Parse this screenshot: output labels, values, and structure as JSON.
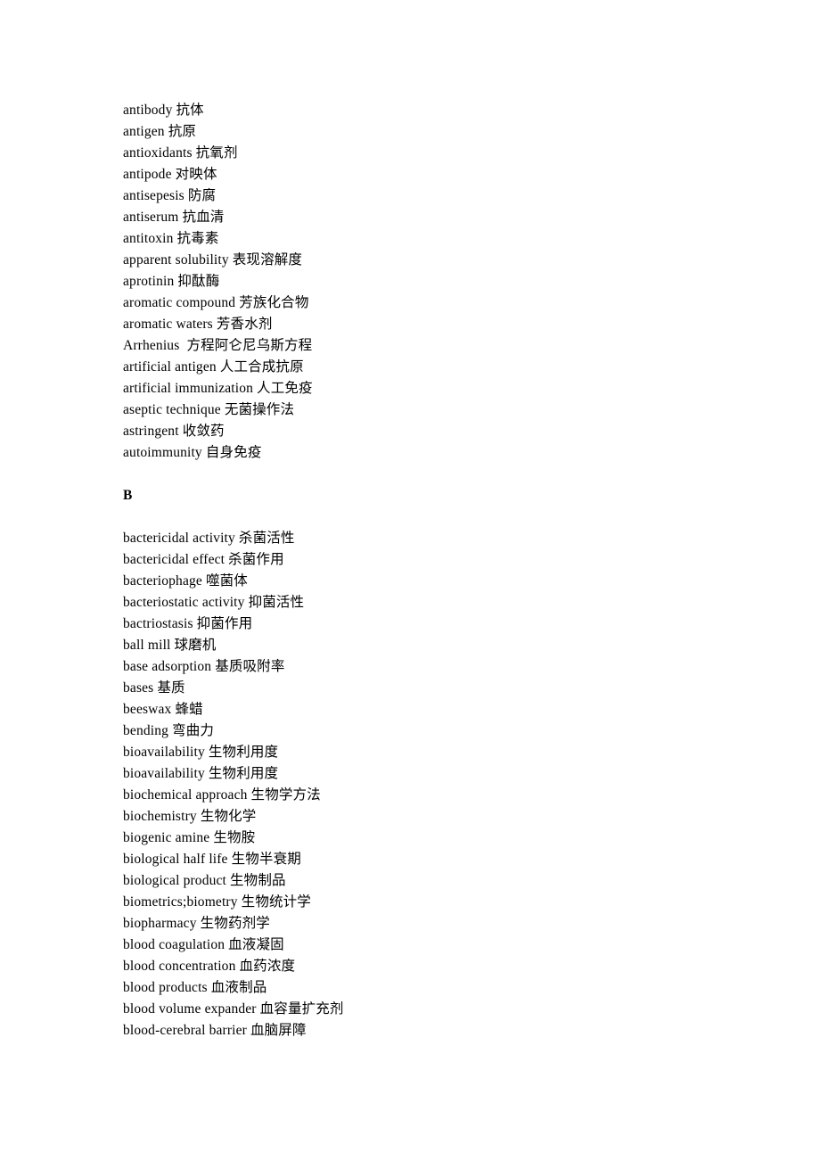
{
  "document": {
    "type": "glossary",
    "language_pair": "English-Chinese",
    "heading_a_section_continued": true
  },
  "blocks": [
    {
      "kind": "entry",
      "text": "antibody 抗体"
    },
    {
      "kind": "entry",
      "text": "antigen 抗原"
    },
    {
      "kind": "entry",
      "text": "antioxidants 抗氧剂"
    },
    {
      "kind": "entry",
      "text": "antipode 对映体"
    },
    {
      "kind": "entry",
      "text": "antisepesis 防腐"
    },
    {
      "kind": "entry",
      "text": "antiserum 抗血清"
    },
    {
      "kind": "entry",
      "text": "antitoxin 抗毒素"
    },
    {
      "kind": "entry",
      "text": "apparent solubility 表现溶解度"
    },
    {
      "kind": "entry",
      "text": "aprotinin 抑酞酶"
    },
    {
      "kind": "entry",
      "text": "aromatic compound 芳族化合物"
    },
    {
      "kind": "entry",
      "text": "aromatic waters 芳香水剂"
    },
    {
      "kind": "entry",
      "text": "Arrhenius  方程阿仑尼乌斯方程"
    },
    {
      "kind": "entry",
      "text": "artificial antigen 人工合成抗原"
    },
    {
      "kind": "entry",
      "text": "artificial immunization 人工免疫"
    },
    {
      "kind": "entry",
      "text": "aseptic technique 无菌操作法"
    },
    {
      "kind": "entry",
      "text": "astringent 收敛药"
    },
    {
      "kind": "entry",
      "text": "autoimmunity 自身免疫"
    },
    {
      "kind": "spacer",
      "text": ""
    },
    {
      "kind": "heading",
      "text": "B"
    },
    {
      "kind": "spacer",
      "text": ""
    },
    {
      "kind": "entry",
      "text": "bactericidal activity 杀菌活性"
    },
    {
      "kind": "entry",
      "text": "bactericidal effect 杀菌作用"
    },
    {
      "kind": "entry",
      "text": "bacteriophage 噬菌体"
    },
    {
      "kind": "entry",
      "text": "bacteriostatic activity 抑菌活性"
    },
    {
      "kind": "entry",
      "text": "bactriostasis 抑菌作用"
    },
    {
      "kind": "entry",
      "text": "ball mill 球磨机"
    },
    {
      "kind": "entry",
      "text": "base adsorption 基质吸附率"
    },
    {
      "kind": "entry",
      "text": "bases 基质"
    },
    {
      "kind": "entry",
      "text": "beeswax 蜂蜡"
    },
    {
      "kind": "entry",
      "text": "bending 弯曲力"
    },
    {
      "kind": "entry",
      "text": "bioavailability 生物利用度"
    },
    {
      "kind": "entry",
      "text": "bioavailability 生物利用度"
    },
    {
      "kind": "entry",
      "text": "biochemical approach 生物学方法"
    },
    {
      "kind": "entry",
      "text": "biochemistry 生物化学"
    },
    {
      "kind": "entry",
      "text": "biogenic amine 生物胺"
    },
    {
      "kind": "entry",
      "text": "biological half life 生物半衰期"
    },
    {
      "kind": "entry",
      "text": "biological product 生物制品"
    },
    {
      "kind": "entry",
      "text": "biometrics;biometry 生物统计学"
    },
    {
      "kind": "entry",
      "text": "biopharmacy 生物药剂学"
    },
    {
      "kind": "entry",
      "text": "blood coagulation 血液凝固"
    },
    {
      "kind": "entry",
      "text": "blood concentration 血药浓度"
    },
    {
      "kind": "entry",
      "text": "blood products 血液制品"
    },
    {
      "kind": "entry",
      "text": "blood volume expander 血容量扩充剂"
    },
    {
      "kind": "entry",
      "text": "blood-cerebral barrier 血脑屏障"
    }
  ]
}
